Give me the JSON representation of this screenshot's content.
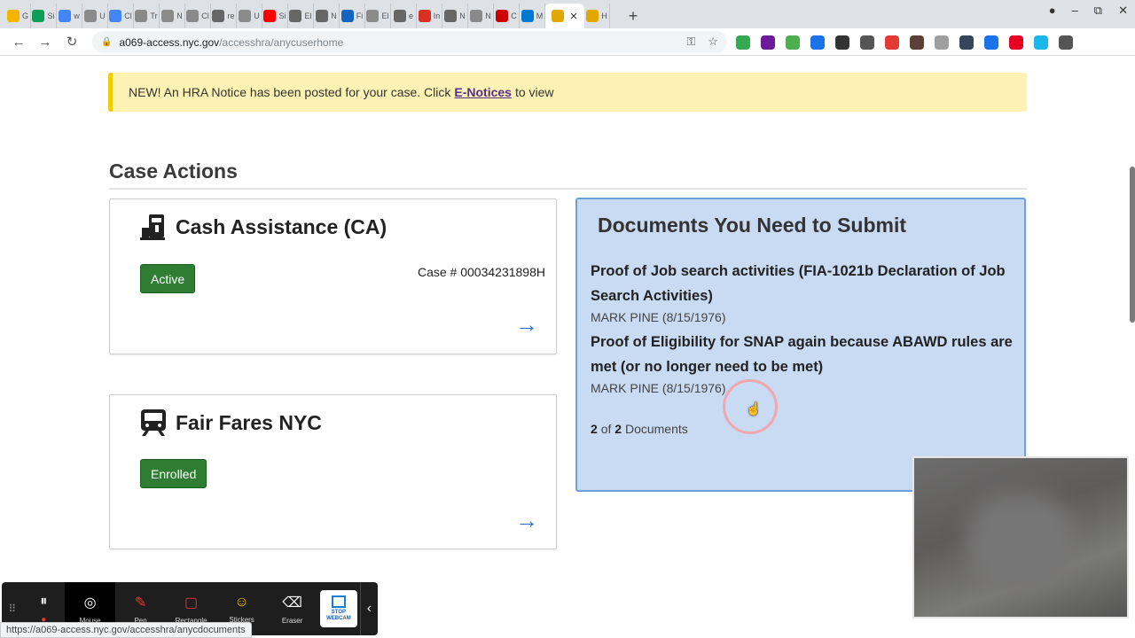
{
  "browser": {
    "tabs": [
      {
        "label": "G",
        "color": "#f4b400"
      },
      {
        "label": "Si",
        "color": "#0f9d58"
      },
      {
        "label": "w",
        "color": "#4285f4"
      },
      {
        "label": "U",
        "color": "#8a8a8a"
      },
      {
        "label": "Cl",
        "color": "#4285f4"
      },
      {
        "label": "Tr",
        "color": "#8a8a8a"
      },
      {
        "label": "N",
        "color": "#8a8a8a"
      },
      {
        "label": "Cl",
        "color": "#8a8a8a"
      },
      {
        "label": "re",
        "color": "#666666"
      },
      {
        "label": "U",
        "color": "#8a8a8a"
      },
      {
        "label": "Si",
        "color": "#ff0000"
      },
      {
        "label": "El",
        "color": "#666666"
      },
      {
        "label": "N",
        "color": "#666666"
      },
      {
        "label": "Fi",
        "color": "#1565c0"
      },
      {
        "label": "El",
        "color": "#8a8a8a"
      },
      {
        "label": "e",
        "color": "#666666"
      },
      {
        "label": "In",
        "color": "#d93025"
      },
      {
        "label": "N",
        "color": "#666666"
      },
      {
        "label": "N",
        "color": "#8a8a8a"
      },
      {
        "label": "C",
        "color": "#cc0000"
      },
      {
        "label": "M",
        "color": "#0078d4"
      }
    ],
    "active_tab": {
      "label": "",
      "color": "#e0a800"
    },
    "last_tab": {
      "label": "H",
      "color": "#e0a800"
    },
    "new_tab_label": "+",
    "address": {
      "host": "a069-access.nyc.gov",
      "path": "/accesshra/anycuserhome"
    },
    "status_url": "https://a069-access.nyc.gov/accesshra/anycdocuments",
    "extensions": [
      "#34a853",
      "#6a1b9a",
      "#4caf50",
      "#1a73e8",
      "#333333",
      "#555555",
      "#e53935",
      "#5d4037",
      "#9e9e9e",
      "#35465c",
      "#1a73e8",
      "#e60023",
      "#1ab7ea",
      "#555555"
    ]
  },
  "notice": {
    "prefix": "NEW! An HRA Notice has been posted for your case. Click",
    "link": "E-Notices",
    "suffix": "to view"
  },
  "case_actions": {
    "title": "Case Actions",
    "cards": [
      {
        "title": "Cash Assistance (CA)",
        "status": "Active",
        "case_number": "Case # 00034231898H"
      },
      {
        "title": "Fair Fares NYC",
        "status": "Enrolled"
      }
    ]
  },
  "documents": {
    "title": "Documents You Need to Submit",
    "items": [
      {
        "name": "Proof of Job search activities (FIA-1021b Declaration of Job Search Activities)",
        "person": "MARK PINE (8/15/1976)"
      },
      {
        "name": "Proof of Eligibility for SNAP again because ABAWD rules are met (or no longer need to be met)",
        "person": "MARK PINE (8/15/1976)"
      }
    ],
    "count_current": "2",
    "count_of": "of",
    "count_total": "2",
    "count_label": "Documents"
  },
  "recorder": {
    "tools": [
      {
        "label": "Mouse",
        "icon": "◎"
      },
      {
        "label": "Pen",
        "icon": "✎"
      },
      {
        "label": "Rectangle",
        "icon": "▢"
      },
      {
        "label": "Stickers",
        "icon": "☺"
      },
      {
        "label": "Eraser",
        "icon": "⌫"
      }
    ],
    "stop_webcam_label": "STOP WEBCAM"
  },
  "colors": {
    "active_badge": "#2e7d32",
    "notice_bg": "#fdf2b3",
    "docs_bg": "#c9daf3",
    "arrow": "#2f72c4"
  }
}
